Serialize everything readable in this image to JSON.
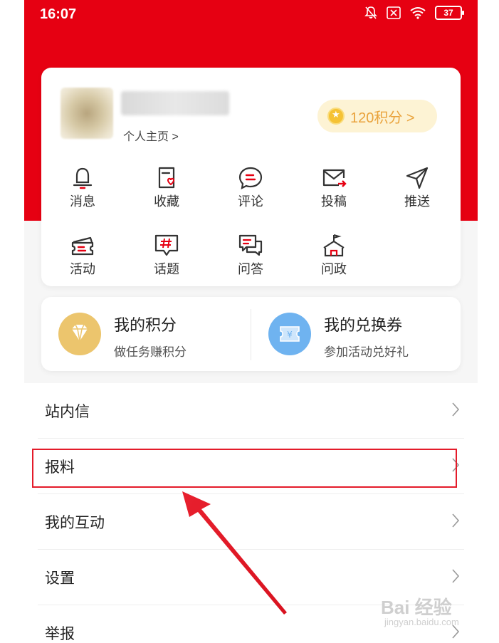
{
  "status_bar": {
    "time": "16:07",
    "battery": "37",
    "icons": [
      "bell-off-icon",
      "sim-off-icon",
      "wifi-icon",
      "battery-icon"
    ]
  },
  "profile": {
    "homepage_link": "个人主页 >",
    "points_badge": "120积分 >",
    "coin_icon": "coin-icon"
  },
  "quick_grid": [
    {
      "label": "消息",
      "icon": "bell-icon"
    },
    {
      "label": "收藏",
      "icon": "favorite-doc-icon"
    },
    {
      "label": "评论",
      "icon": "comment-icon"
    },
    {
      "label": "投稿",
      "icon": "mail-send-icon"
    },
    {
      "label": "推送",
      "icon": "send-arrow-icon"
    },
    {
      "label": "活动",
      "icon": "ticket-icon"
    },
    {
      "label": "话题",
      "icon": "hashtag-icon"
    },
    {
      "label": "问答",
      "icon": "qa-chat-icon"
    },
    {
      "label": "问政",
      "icon": "government-building-icon"
    }
  ],
  "points_card": {
    "my_points_title": "我的积分",
    "my_points_sub": "做任务赚积分",
    "my_coupons_title": "我的兑换券",
    "my_coupons_sub": "参加活动兑好礼"
  },
  "menu": [
    {
      "label": "站内信"
    },
    {
      "label": "报料"
    },
    {
      "label": "我的互动"
    },
    {
      "label": "设置"
    },
    {
      "label": "举报"
    }
  ],
  "watermark": {
    "text": "Bai 经验",
    "sub": "jingyan.baidu.com"
  },
  "colors": {
    "brand_red": "#e60012",
    "points_gold": "#e9a23b",
    "coupon_blue": "#6fb3f0",
    "highlight_red": "#e41b2a"
  }
}
